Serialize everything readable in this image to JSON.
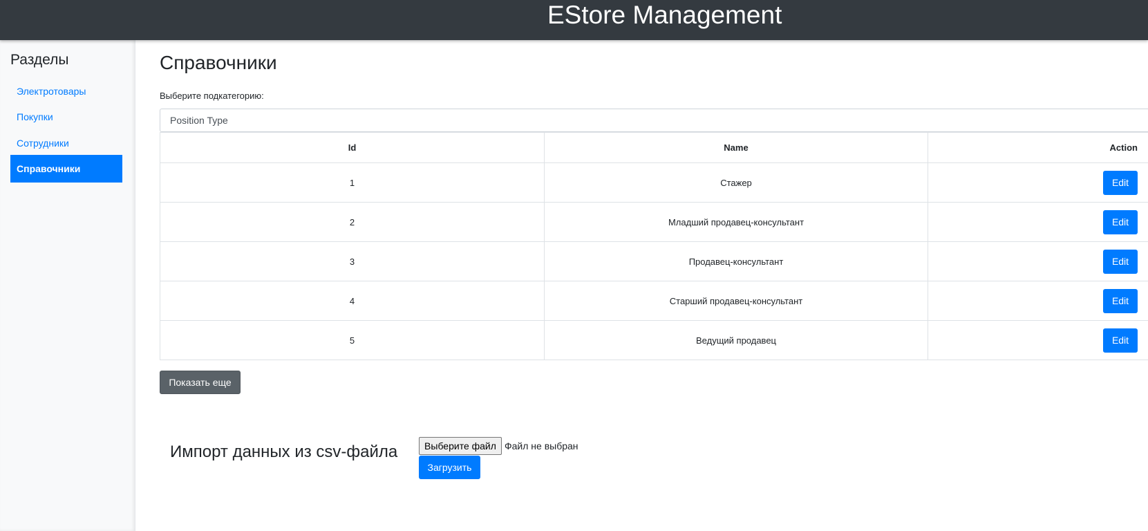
{
  "header": {
    "title": "EStore Management"
  },
  "sidebar": {
    "heading": "Разделы",
    "items": [
      {
        "label": "Электротовары",
        "active": false
      },
      {
        "label": "Покупки",
        "active": false
      },
      {
        "label": "Сотрудники",
        "active": false
      },
      {
        "label": "Справочники",
        "active": true
      }
    ]
  },
  "main": {
    "title": "Справочники",
    "subcategory_label": "Выберите подкатегорию:",
    "subcategory_selected": "Position Type",
    "table": {
      "columns": [
        "Id",
        "Name",
        "Action"
      ],
      "rows": [
        {
          "id": "1",
          "name": "Стажер",
          "action": "Edit"
        },
        {
          "id": "2",
          "name": "Младший продавец-консультант",
          "action": "Edit"
        },
        {
          "id": "3",
          "name": "Продавец-консультант",
          "action": "Edit"
        },
        {
          "id": "4",
          "name": "Старший продавец-консультант",
          "action": "Edit"
        },
        {
          "id": "5",
          "name": "Ведущий продавец",
          "action": "Edit"
        }
      ]
    },
    "show_more_label": "Показать еще"
  },
  "import": {
    "label": "Импорт данных из csv-файла",
    "choose_file_label": "Выберите файл",
    "file_status": "Файл не выбран",
    "upload_label": "Загрузить"
  },
  "colors": {
    "header_bg": "#343a40",
    "accent": "#007bff",
    "secondary": "#5a6268",
    "sidebar_bg": "#f8f9fa"
  }
}
